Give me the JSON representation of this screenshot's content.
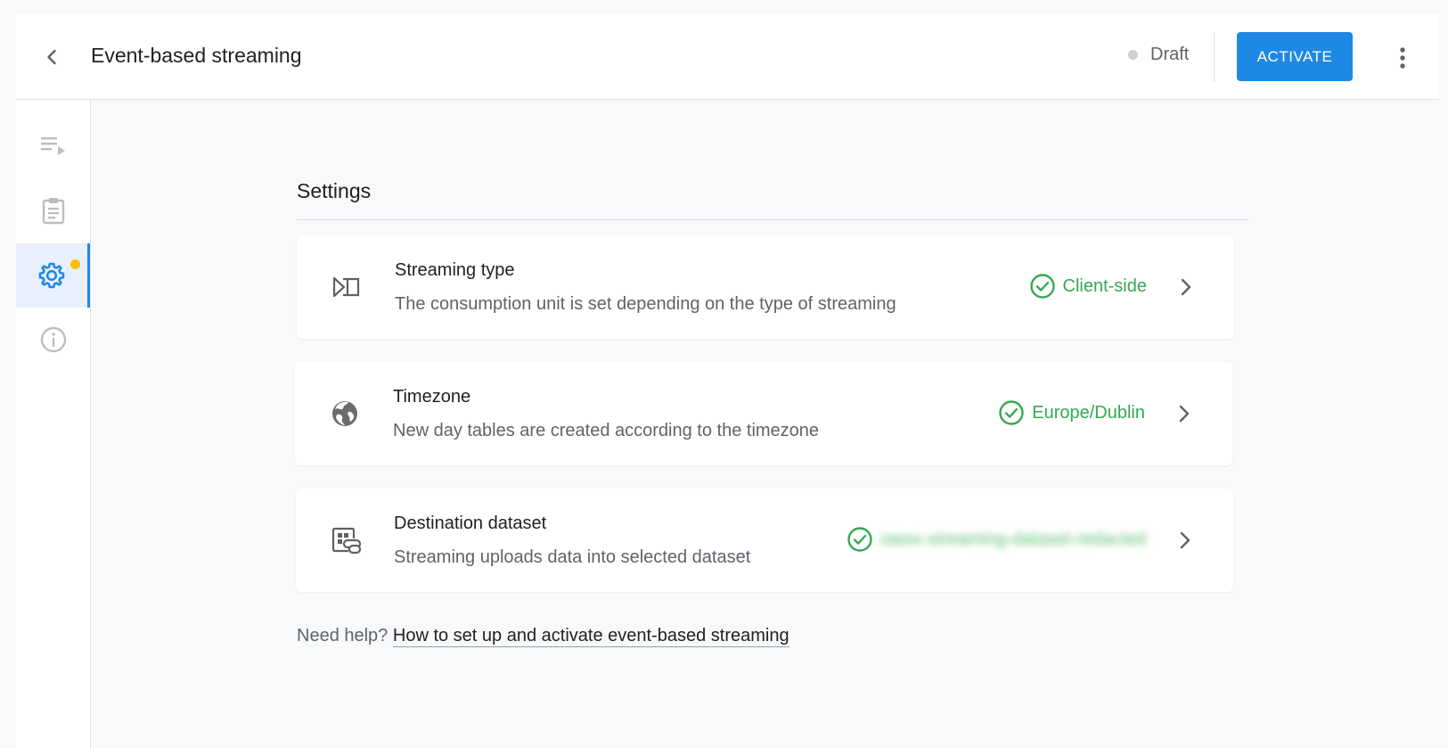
{
  "header": {
    "back_icon": "arrow-back-icon",
    "title": "Event-based streaming",
    "status": "Draft",
    "status_color": "#cfcfcf",
    "activate_label": "ACTIVATE",
    "more_icon": "more-vert-icon"
  },
  "sidenav": {
    "items": [
      {
        "name": "playlist-icon",
        "active": false
      },
      {
        "name": "clipboard-icon",
        "active": false
      },
      {
        "name": "settings-icon",
        "active": true,
        "badge_color": "#fbbc04"
      },
      {
        "name": "info-icon",
        "active": false
      }
    ]
  },
  "settings": {
    "title": "Settings",
    "cards": [
      {
        "icon": "streaming-type-icon",
        "title": "Streaming type",
        "description": "The consumption unit is set depending on the type of streaming",
        "value": "Client-side"
      },
      {
        "icon": "globe-icon",
        "title": "Timezone",
        "description": "New day tables are created according to the timezone",
        "value": "Europe/Dublin"
      },
      {
        "icon": "dataset-link-icon",
        "title": "Destination dataset",
        "description": "Streaming uploads data into selected dataset",
        "value": "owox-streaming-dataset-redacted"
      }
    ]
  },
  "help": {
    "prefix": "Need help?",
    "link_text": "How to set up and activate event-based streaming"
  },
  "colors": {
    "accent": "#1e88e5",
    "success": "#34a853",
    "badge": "#fbbc04"
  }
}
